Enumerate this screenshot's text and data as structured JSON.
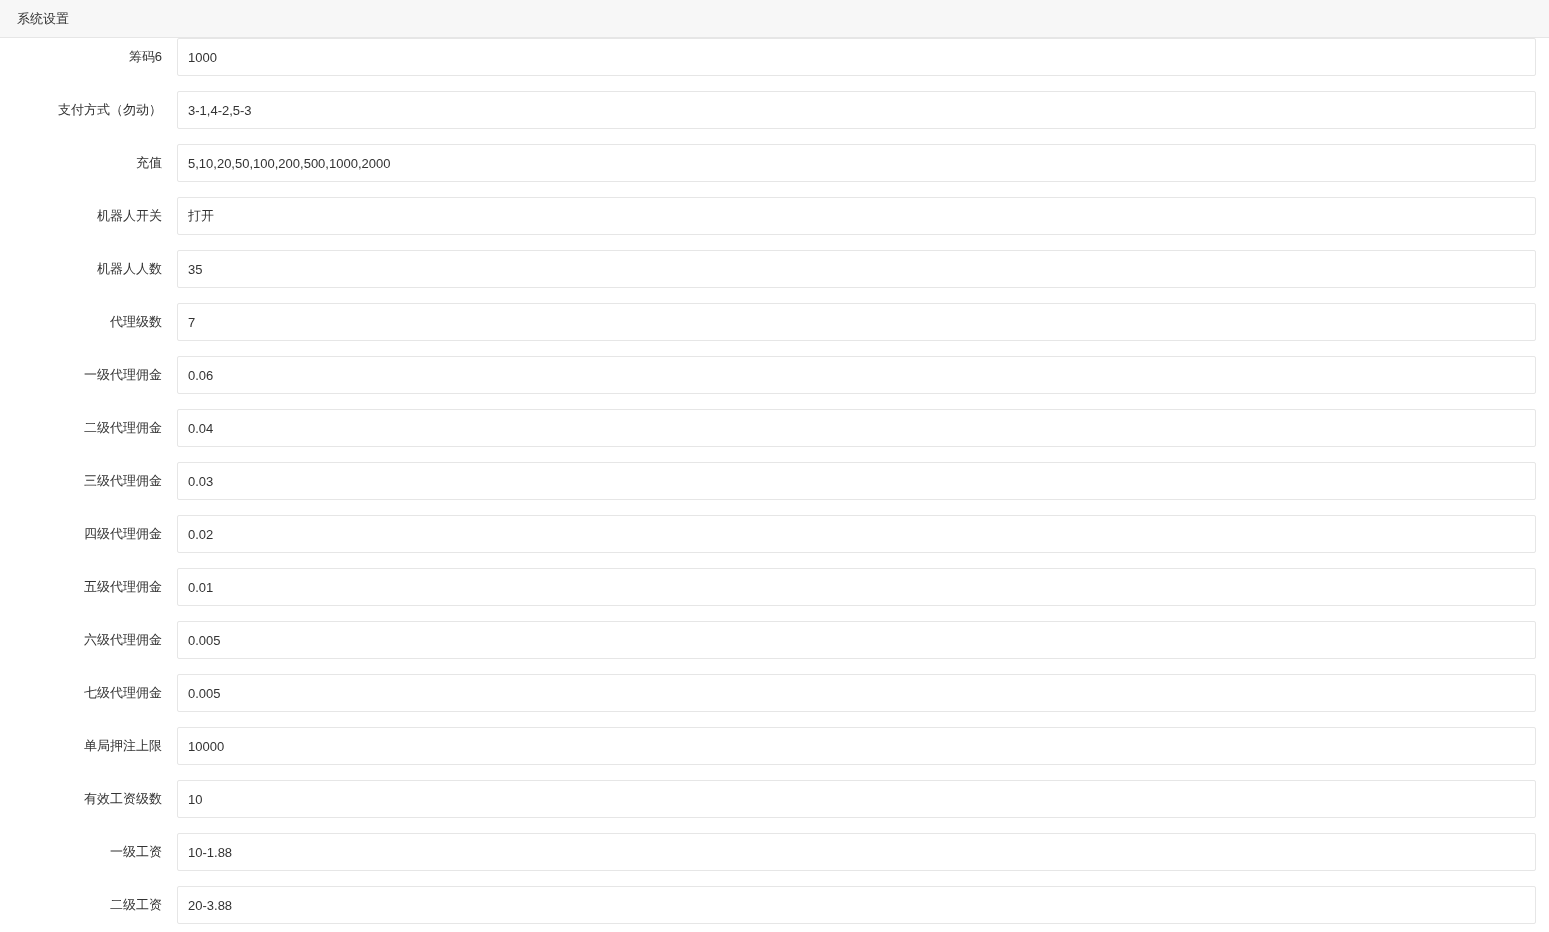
{
  "panel": {
    "title": "系统设置"
  },
  "fields": [
    {
      "label": "筹码6",
      "value": "1000"
    },
    {
      "label": "支付方式（勿动）",
      "value": "3-1,4-2,5-3"
    },
    {
      "label": "充值",
      "value": "5,10,20,50,100,200,500,1000,2000"
    },
    {
      "label": "机器人开关",
      "value": "打开"
    },
    {
      "label": "机器人人数",
      "value": "35"
    },
    {
      "label": "代理级数",
      "value": "7"
    },
    {
      "label": "一级代理佣金",
      "value": "0.06"
    },
    {
      "label": "二级代理佣金",
      "value": "0.04"
    },
    {
      "label": "三级代理佣金",
      "value": "0.03"
    },
    {
      "label": "四级代理佣金",
      "value": "0.02"
    },
    {
      "label": "五级代理佣金",
      "value": "0.01"
    },
    {
      "label": "六级代理佣金",
      "value": "0.005"
    },
    {
      "label": "七级代理佣金",
      "value": "0.005"
    },
    {
      "label": "单局押注上限",
      "value": "10000"
    },
    {
      "label": "有效工资级数",
      "value": "10"
    },
    {
      "label": "一级工资",
      "value": "10-1.88"
    },
    {
      "label": "二级工资",
      "value": "20-3.88"
    }
  ]
}
